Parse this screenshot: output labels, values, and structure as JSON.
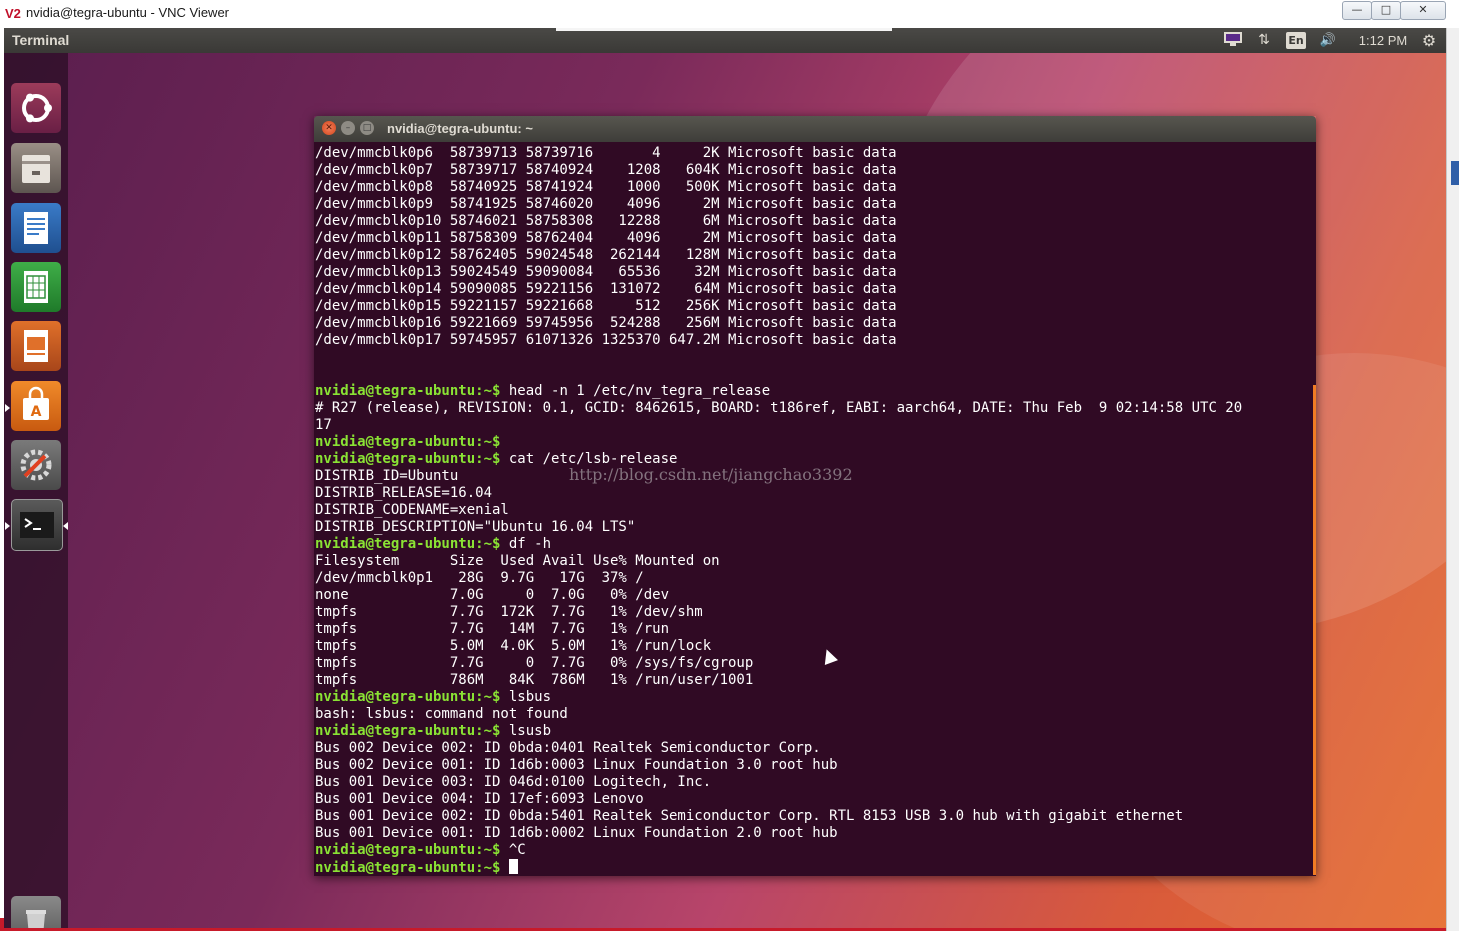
{
  "vnc": {
    "logo": "V2",
    "title": "nvidia@tegra-ubuntu - VNC Viewer",
    "min": "—",
    "max": "□",
    "close": "✕"
  },
  "panel": {
    "app_name": "Terminal",
    "lang": "En",
    "clock": "1:12 PM",
    "icons": [
      "display-icon",
      "network-icon",
      "volume-icon",
      "gear-icon"
    ]
  },
  "launcher": {
    "items": [
      "dash",
      "files",
      "libreoffice-writer",
      "libreoffice-calc",
      "libreoffice-impress",
      "ubuntu-software",
      "system-settings",
      "terminal",
      "trash"
    ]
  },
  "terminal": {
    "title": "nvidia@tegra-ubuntu: ~",
    "prompt": "nvidia@tegra-ubuntu:~$",
    "lines": [
      {
        "t": "/dev/mmcblk0p6  58739713 58739716       4     2K Microsoft basic data"
      },
      {
        "t": "/dev/mmcblk0p7  58739717 58740924    1208   604K Microsoft basic data"
      },
      {
        "t": "/dev/mmcblk0p8  58740925 58741924    1000   500K Microsoft basic data"
      },
      {
        "t": "/dev/mmcblk0p9  58741925 58746020    4096     2M Microsoft basic data"
      },
      {
        "t": "/dev/mmcblk0p10 58746021 58758308   12288     6M Microsoft basic data"
      },
      {
        "t": "/dev/mmcblk0p11 58758309 58762404    4096     2M Microsoft basic data"
      },
      {
        "t": "/dev/mmcblk0p12 58762405 59024548  262144   128M Microsoft basic data"
      },
      {
        "t": "/dev/mmcblk0p13 59024549 59090084   65536    32M Microsoft basic data"
      },
      {
        "t": "/dev/mmcblk0p14 59090085 59221156  131072    64M Microsoft basic data"
      },
      {
        "t": "/dev/mmcblk0p15 59221157 59221668     512   256K Microsoft basic data"
      },
      {
        "t": "/dev/mmcblk0p16 59221669 59745956  524288   256M Microsoft basic data"
      },
      {
        "t": "/dev/mmcblk0p17 59745957 61071326 1325370 647.2M Microsoft basic data"
      },
      {
        "t": ""
      },
      {
        "t": ""
      },
      {
        "p": true,
        "t": " head -n 1 /etc/nv_tegra_release"
      },
      {
        "t": "# R27 (release), REVISION: 0.1, GCID: 8462615, BOARD: t186ref, EABI: aarch64, DATE: Thu Feb  9 02:14:58 UTC 20"
      },
      {
        "t": "17"
      },
      {
        "p": true,
        "t": ""
      },
      {
        "p": true,
        "t": " cat /etc/lsb-release"
      },
      {
        "t": "DISTRIB_ID=Ubuntu"
      },
      {
        "t": "DISTRIB_RELEASE=16.04"
      },
      {
        "t": "DISTRIB_CODENAME=xenial"
      },
      {
        "t": "DISTRIB_DESCRIPTION=\"Ubuntu 16.04 LTS\""
      },
      {
        "p": true,
        "t": " df -h"
      },
      {
        "t": "Filesystem      Size  Used Avail Use% Mounted on"
      },
      {
        "t": "/dev/mmcblk0p1   28G  9.7G   17G  37% /"
      },
      {
        "t": "none            7.0G     0  7.0G   0% /dev"
      },
      {
        "t": "tmpfs           7.7G  172K  7.7G   1% /dev/shm"
      },
      {
        "t": "tmpfs           7.7G   14M  7.7G   1% /run"
      },
      {
        "t": "tmpfs           5.0M  4.0K  5.0M   1% /run/lock"
      },
      {
        "t": "tmpfs           7.7G     0  7.7G   0% /sys/fs/cgroup"
      },
      {
        "t": "tmpfs           786M   84K  786M   1% /run/user/1001"
      },
      {
        "p": true,
        "t": " lsbus"
      },
      {
        "t": "bash: lsbus: command not found"
      },
      {
        "p": true,
        "t": " lsusb"
      },
      {
        "t": "Bus 002 Device 002: ID 0bda:0401 Realtek Semiconductor Corp."
      },
      {
        "t": "Bus 002 Device 001: ID 1d6b:0003 Linux Foundation 3.0 root hub"
      },
      {
        "t": "Bus 001 Device 003: ID 046d:0100 Logitech, Inc."
      },
      {
        "t": "Bus 001 Device 004: ID 17ef:6093 Lenovo"
      },
      {
        "t": "Bus 001 Device 002: ID 0bda:5401 Realtek Semiconductor Corp. RTL 8153 USB 3.0 hub with gigabit ethernet"
      },
      {
        "t": "Bus 001 Device 001: ID 1d6b:0002 Linux Foundation 2.0 root hub"
      },
      {
        "p": true,
        "t": " ^C"
      },
      {
        "p": true,
        "t": " ",
        "cursor": true
      }
    ],
    "watermark": "http://blog.csdn.net/jiangchao3392"
  },
  "colors": {
    "terminal_bg": "#300a24",
    "prompt": "#8ae234",
    "scroll_accent": "#f07c24",
    "launcher_bg": "#280e22"
  }
}
